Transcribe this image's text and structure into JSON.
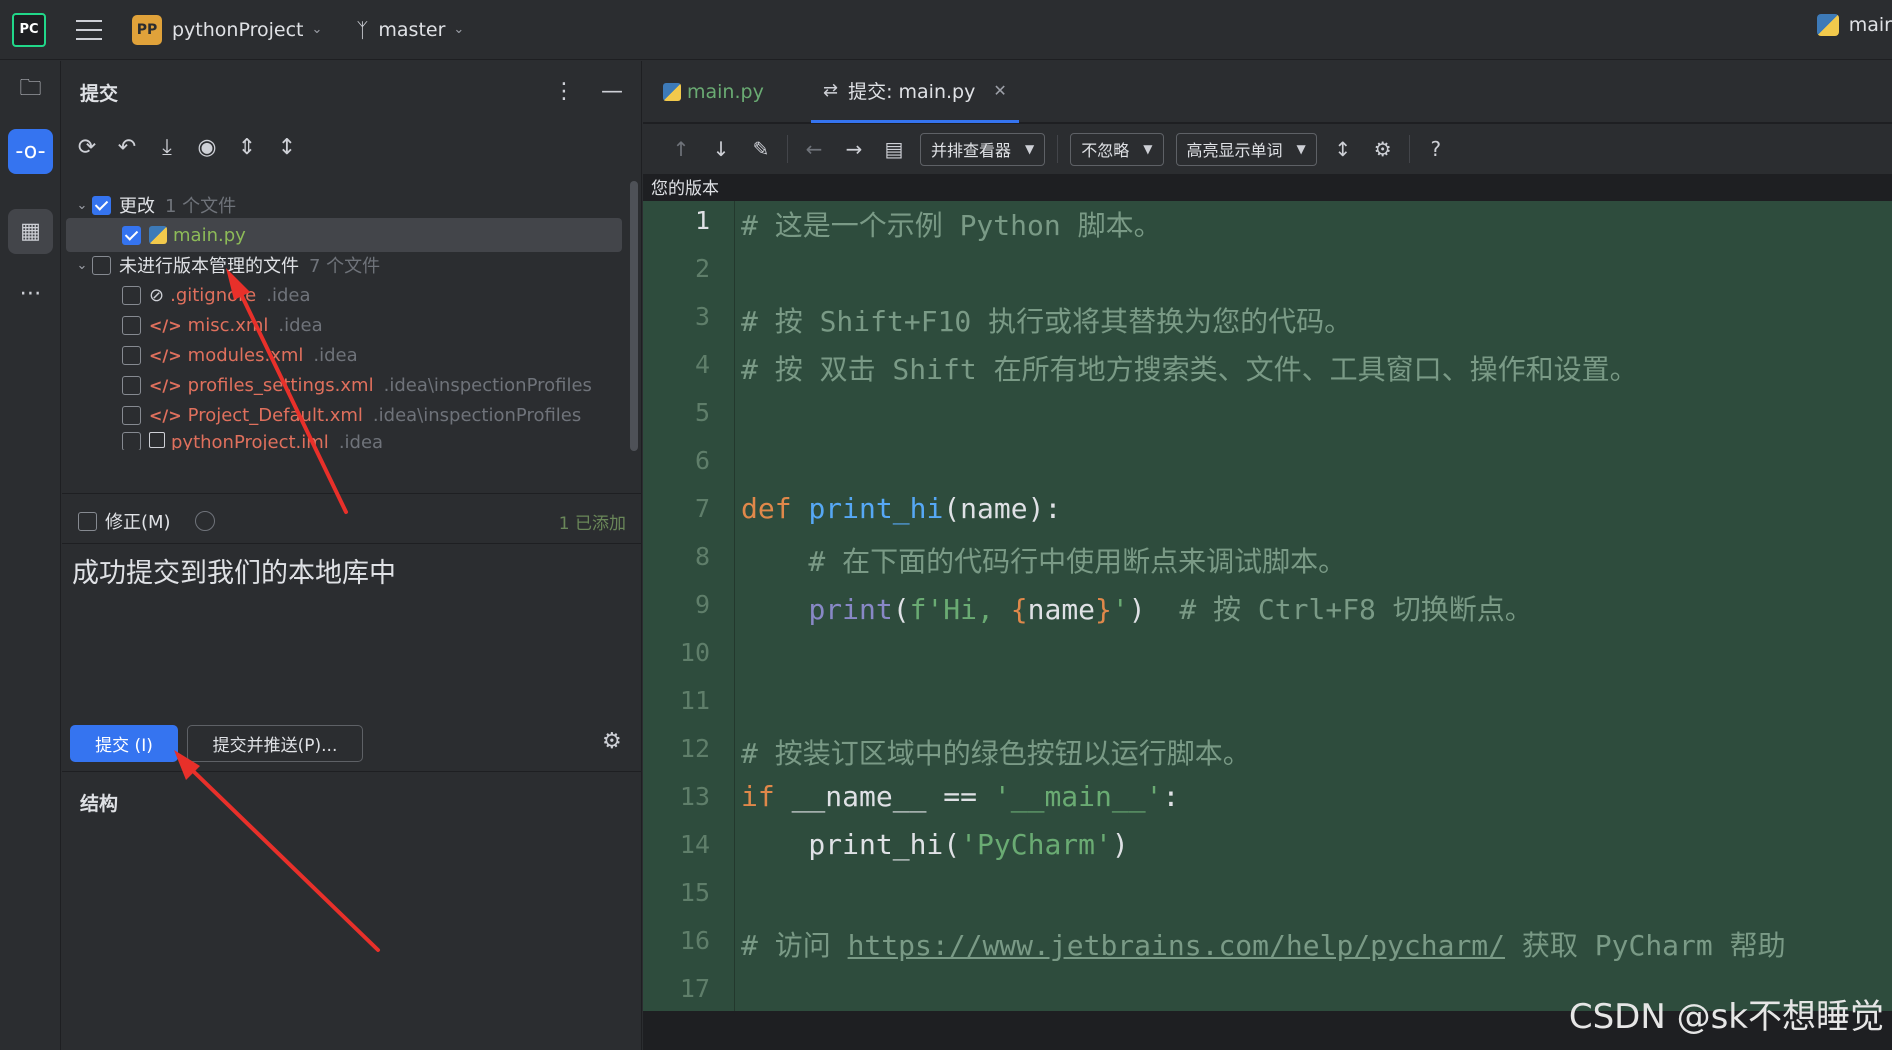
{
  "titlebar": {
    "logo": "PC",
    "project_badge": "PP",
    "project_name": "pythonProject",
    "branch": "master",
    "run_config": "mair"
  },
  "commit_panel": {
    "title": "提交",
    "toolbar_icons": [
      "refresh-icon",
      "rollback-icon",
      "update-icon",
      "eye-icon",
      "expand-icon",
      "collapse-icon"
    ],
    "groups": [
      {
        "label": "更改",
        "count": "1 个文件",
        "checked": true
      },
      {
        "label": "未进行版本管理的文件",
        "count": "7 个文件",
        "checked": false
      }
    ],
    "files": [
      {
        "name": "main.py",
        "path": "",
        "color": "#8dbb58",
        "checked": true
      },
      {
        "name": ".gitignore",
        "path": ".idea",
        "color": "#e0705d",
        "checked": false
      },
      {
        "name": "misc.xml",
        "path": ".idea",
        "color": "#e0705d",
        "checked": false
      },
      {
        "name": "modules.xml",
        "path": ".idea",
        "color": "#e0705d",
        "checked": false
      },
      {
        "name": "profiles_settings.xml",
        "path": ".idea\\inspectionProfiles",
        "color": "#e0705d",
        "checked": false
      },
      {
        "name": "Project_Default.xml",
        "path": ".idea\\inspectionProfiles",
        "color": "#e0705d",
        "checked": false
      },
      {
        "name": "pythonProject.iml",
        "path": ".idea",
        "color": "#e0705d",
        "checked": false
      }
    ],
    "amend_label": "修正(M)",
    "added_label": "1 已添加",
    "commit_message": "成功提交到我们的本地库中",
    "commit_button": "提交 (I)",
    "commit_push_button": "提交并推送(P)...",
    "structure_title": "结构"
  },
  "editor": {
    "tabs": [
      {
        "label": "main.py",
        "active": false
      },
      {
        "label": "提交: main.py",
        "active": true
      }
    ],
    "diff_toolbar": {
      "viewer_mode": "并排查看器",
      "ignore_mode": "不忽略",
      "highlight_mode": "高亮显示单词"
    },
    "version_label": "您的版本",
    "line_numbers": [
      "1",
      "2",
      "3",
      "4",
      "5",
      "6",
      "7",
      "8",
      "9",
      "10",
      "11",
      "12",
      "13",
      "14",
      "15",
      "16",
      "17"
    ],
    "code": {
      "l1": "# 这是一个示例 Python 脚本。",
      "l3": "# 按 Shift+F10 执行或将其替换为您的代码。",
      "l4": "# 按 双击 Shift 在所有地方搜索类、文件、工具窗口、操作和设置。",
      "l7_kw": "def ",
      "l7_fn": "print_hi",
      "l7_rest": "(name):",
      "l8": "    # 在下面的代码行中使用断点来调试脚本。",
      "l9_bi": "print",
      "l9_a": "(",
      "l9_str1": "f'Hi, ",
      "l9_br1": "{",
      "l9_name": "name",
      "l9_br2": "}",
      "l9_str2": "'",
      "l9_close": ")  ",
      "l9_cm": "# 按 Ctrl+F8 切换断点。",
      "l12": "# 按装订区域中的绿色按钮以运行脚本。",
      "l13_kw": "if ",
      "l13_a": "__name__ == ",
      "l13_str": "'__main__'",
      "l13_b": ":",
      "l14_a": "    print_hi(",
      "l14_str": "'PyCharm'",
      "l14_b": ")",
      "l16_a": "# 访问 ",
      "l16_link": "https://www.jetbrains.com/help/pycharm/",
      "l16_b": " 获取 PyCharm 帮助"
    }
  },
  "watermark": "CSDN @sk不想睡觉",
  "colors": {
    "accent": "#3574f0",
    "diff_bg": "#2e4c3d",
    "arrow": "#e8302a"
  }
}
